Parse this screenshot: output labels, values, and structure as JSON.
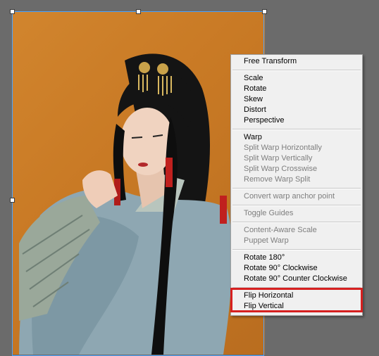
{
  "menu": {
    "free_transform": "Free Transform",
    "scale": "Scale",
    "rotate": "Rotate",
    "skew": "Skew",
    "distort": "Distort",
    "perspective": "Perspective",
    "warp": "Warp",
    "split_warp_horizontally": "Split Warp Horizontally",
    "split_warp_vertically": "Split Warp Vertically",
    "split_warp_crosswise": "Split Warp Crosswise",
    "remove_warp_split": "Remove Warp Split",
    "convert_warp_anchor_point": "Convert warp anchor point",
    "toggle_guides": "Toggle Guides",
    "content_aware_scale": "Content-Aware Scale",
    "puppet_warp": "Puppet Warp",
    "rotate_180": "Rotate 180°",
    "rotate_90_cw": "Rotate 90° Clockwise",
    "rotate_90_ccw": "Rotate 90° Counter Clockwise",
    "flip_horizontal": "Flip Horizontal",
    "flip_vertical": "Flip Vertical"
  },
  "colors": {
    "workspace": "#6b6b6b",
    "menu_bg": "#f0f0f0",
    "disabled_text": "#7e7e7e",
    "highlight": "#d62020",
    "transform_border": "#4aa3ff"
  }
}
